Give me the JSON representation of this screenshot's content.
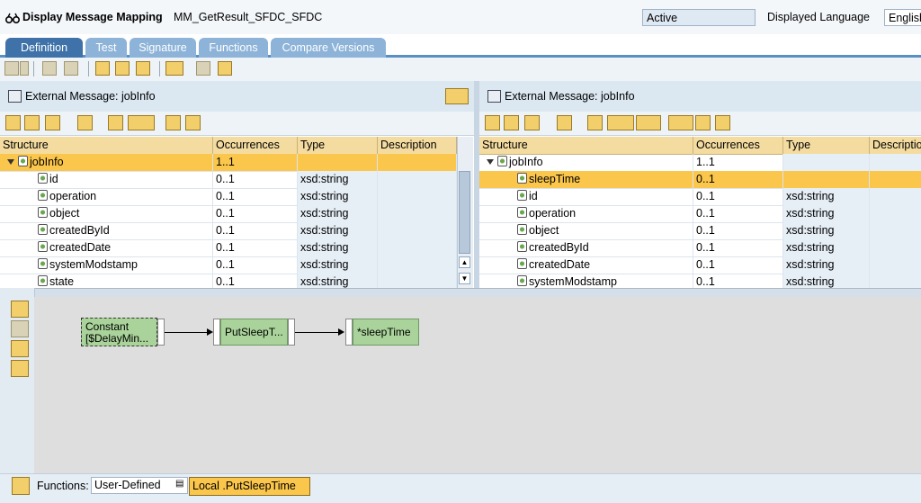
{
  "header": {
    "title": "Display Message Mapping",
    "object_name": "MM_GetResult_SFDC_SFDC",
    "status": "Active",
    "language_label": "Displayed Language",
    "language_value": "English"
  },
  "tabs": [
    "Definition",
    "Test",
    "Signature",
    "Functions",
    "Compare Versions"
  ],
  "source": {
    "caption": "External Message: jobInfo",
    "columns": [
      "Structure",
      "Occurrences",
      "Type",
      "Description"
    ],
    "rows": [
      {
        "name": "jobInfo",
        "occ": "1..1",
        "type": "",
        "desc": ""
      },
      {
        "name": "id",
        "occ": "0..1",
        "type": "xsd:string",
        "desc": ""
      },
      {
        "name": "operation",
        "occ": "0..1",
        "type": "xsd:string",
        "desc": ""
      },
      {
        "name": "object",
        "occ": "0..1",
        "type": "xsd:string",
        "desc": ""
      },
      {
        "name": "createdById",
        "occ": "0..1",
        "type": "xsd:string",
        "desc": ""
      },
      {
        "name": "createdDate",
        "occ": "0..1",
        "type": "xsd:string",
        "desc": ""
      },
      {
        "name": "systemModstamp",
        "occ": "0..1",
        "type": "xsd:string",
        "desc": ""
      },
      {
        "name": "state",
        "occ": "0..1",
        "type": "xsd:string",
        "desc": ""
      }
    ]
  },
  "target": {
    "caption": "External Message: jobInfo",
    "columns": [
      "Structure",
      "Occurrences",
      "Type",
      "Description"
    ],
    "rows": [
      {
        "name": "jobInfo",
        "occ": "1..1",
        "type": "",
        "desc": ""
      },
      {
        "name": "sleepTime",
        "occ": "0..1",
        "type": "",
        "desc": ""
      },
      {
        "name": "id",
        "occ": "0..1",
        "type": "xsd:string",
        "desc": ""
      },
      {
        "name": "operation",
        "occ": "0..1",
        "type": "xsd:string",
        "desc": ""
      },
      {
        "name": "object",
        "occ": "0..1",
        "type": "xsd:string",
        "desc": ""
      },
      {
        "name": "createdById",
        "occ": "0..1",
        "type": "xsd:string",
        "desc": ""
      },
      {
        "name": "createdDate",
        "occ": "0..1",
        "type": "xsd:string",
        "desc": ""
      },
      {
        "name": "systemModstamp",
        "occ": "0..1",
        "type": "xsd:string",
        "desc": ""
      }
    ]
  },
  "mapping": {
    "constant_line1": "Constant",
    "constant_line2": "[$DelayMin...",
    "function_box": "PutSleepT...",
    "target_box": "*sleepTime"
  },
  "footer": {
    "functions_label": "Functions:",
    "functions_select": "User-Defined",
    "functions_value": "Local .PutSleepTime"
  },
  "colors": {
    "tab_active": "#3e72a8",
    "tab_inactive": "#8db3d8",
    "header_row": "#f4dca0",
    "selection": "#fbc64c",
    "mapping_box": "#a9d39a"
  }
}
